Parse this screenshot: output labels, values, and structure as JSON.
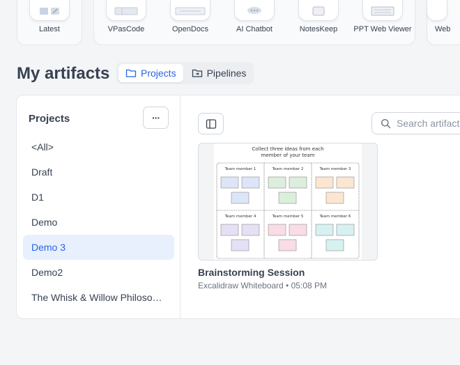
{
  "apps": [
    {
      "label": "Latest",
      "icon": "latest-icon"
    },
    {
      "label": "VPasCode",
      "icon": "code-icon"
    },
    {
      "label": "OpenDocs",
      "icon": "docs-icon"
    },
    {
      "label": "AI Chatbot",
      "icon": "chat-icon"
    },
    {
      "label": "NotesKeep",
      "icon": "notes-icon"
    },
    {
      "label": "PPT Web Viewer",
      "icon": "slides-icon"
    },
    {
      "label": "Web",
      "icon": "web-icon"
    }
  ],
  "header": {
    "title": "My artifacts",
    "tabs": [
      {
        "label": "Projects",
        "icon": "folder-icon",
        "active": true
      },
      {
        "label": "Pipelines",
        "icon": "pipeline-icon",
        "active": false
      }
    ]
  },
  "sidebar": {
    "title": "Projects",
    "more_label": "···",
    "items": [
      {
        "label": "<All>"
      },
      {
        "label": "Draft"
      },
      {
        "label": "D1"
      },
      {
        "label": "Demo"
      },
      {
        "label": "Demo 3",
        "active": true
      },
      {
        "label": "Demo2"
      },
      {
        "label": "The Whisk & Willow Philosophy Café"
      }
    ]
  },
  "content": {
    "search_placeholder": "Search artifacts",
    "card": {
      "title": "Brainstorming Session",
      "meta": "Excalidraw Whiteboard • 05:08 PM",
      "thumbnail": {
        "heading_line1": "Collect three ideas from each",
        "heading_line2": "member of your team",
        "members": [
          "Team member 1",
          "Team member 2",
          "Team member 3",
          "Team member 4",
          "Team member 5",
          "Team member 6"
        ],
        "note_colors": [
          "#dde6f8",
          "#dcefdc",
          "#fbe6d2",
          "#e6e0f5",
          "#f8dde6",
          "#d7f0f0"
        ]
      }
    }
  },
  "colors": {
    "accent": "#2563eb",
    "active_bg": "#e8f0fd"
  }
}
